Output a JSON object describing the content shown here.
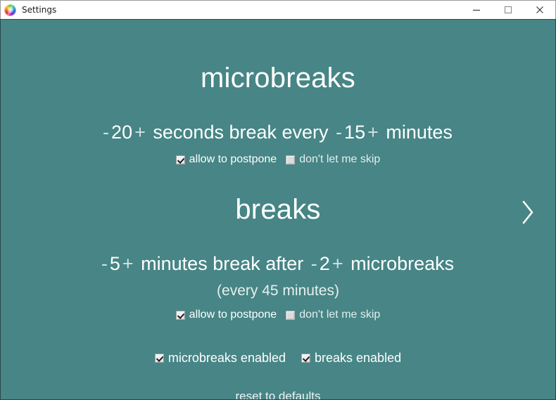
{
  "window": {
    "title": "Settings",
    "app_icon": "rainbow-swirl-icon",
    "controls": {
      "minimize": "minimize-icon",
      "maximize": "maximize-icon",
      "close": "close-icon"
    }
  },
  "theme": {
    "background": "#478586",
    "text": "#ffffff",
    "dim_text": "#cfe3e3",
    "titlebar_background": "#ffffff",
    "titlebar_text": "#1b1b1b"
  },
  "sections": {
    "microbreaks": {
      "heading": "microbreaks",
      "duration": {
        "minus": "-",
        "value": "20",
        "plus": "+",
        "unit_label": "seconds break every"
      },
      "interval": {
        "minus": "-",
        "value": "15",
        "plus": "+",
        "unit_label": "minutes"
      },
      "options": [
        {
          "label": "allow to postpone",
          "checked": true,
          "disabled": false
        },
        {
          "label": "don't let me skip",
          "checked": false,
          "disabled": true
        }
      ]
    },
    "breaks": {
      "heading": "breaks",
      "duration": {
        "minus": "-",
        "value": "5",
        "plus": "+",
        "unit_label": "minutes break after"
      },
      "interval": {
        "minus": "-",
        "value": "2",
        "plus": "+",
        "unit_label": "microbreaks"
      },
      "note": "(every 45 minutes)",
      "options": [
        {
          "label": "allow to postpone",
          "checked": true,
          "disabled": false
        },
        {
          "label": "don't let me skip",
          "checked": false,
          "disabled": true
        }
      ]
    }
  },
  "footer": {
    "toggles": [
      {
        "label": "microbreaks enabled",
        "checked": true
      },
      {
        "label": "breaks enabled",
        "checked": true
      }
    ],
    "reset_label": "reset to defaults"
  },
  "navigation": {
    "next": "›",
    "next_icon": "chevron-right-icon"
  }
}
